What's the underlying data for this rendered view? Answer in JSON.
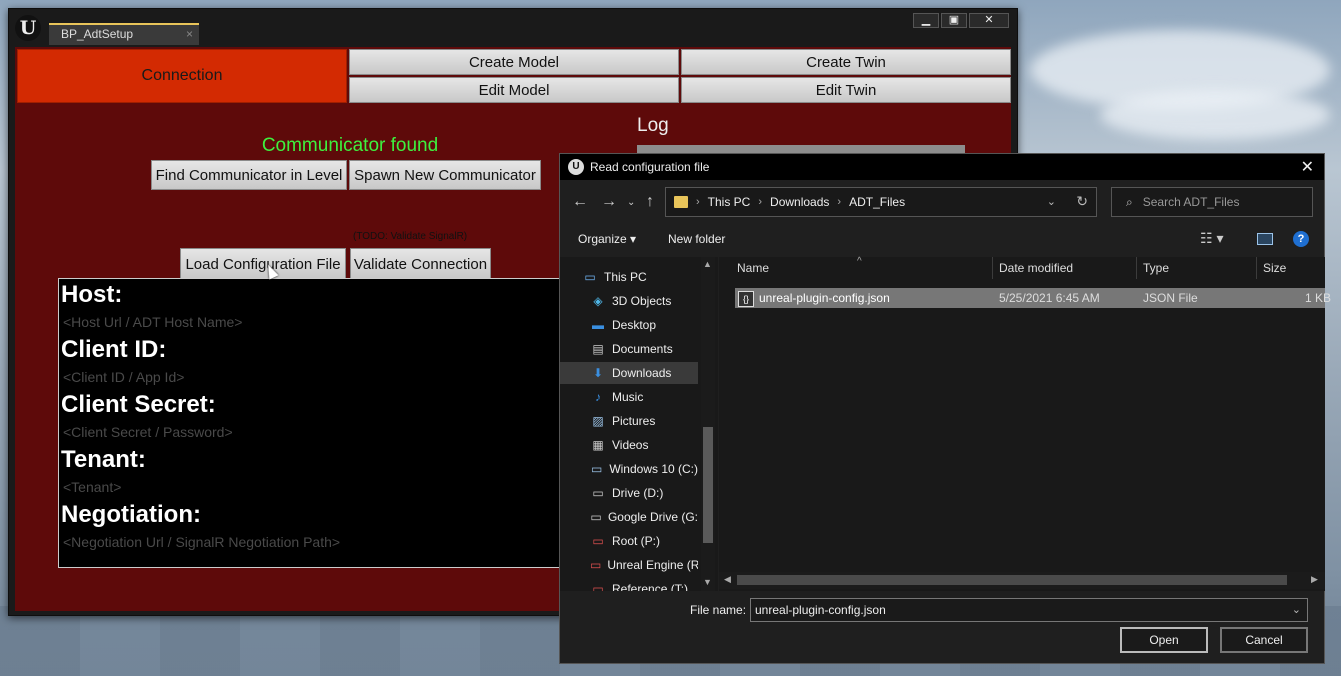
{
  "ue": {
    "logo": "U",
    "tab_title": "BP_AdtSetup",
    "tab_close": "×",
    "ctrl_min": "▁",
    "ctrl_max": "▣",
    "ctrl_close": "✕"
  },
  "nav_buttons": {
    "connection": "Connection",
    "create_model": "Create Model",
    "create_twin": "Create Twin",
    "edit_model": "Edit Model",
    "edit_twin": "Edit Twin"
  },
  "log_label": "Log",
  "status": {
    "communicator": "Communicator found",
    "status_color": "#3ef03e"
  },
  "actions": {
    "find": "Find Communicator in Level",
    "spawn": "Spawn New Communicator",
    "todo": "(TODO: Validate SignalR)",
    "load": "Load Configuration File",
    "validate": "Validate Connection"
  },
  "form": [
    {
      "label": "Host:",
      "hint": "<Host Url / ADT Host Name>"
    },
    {
      "label": "Client ID:",
      "hint": "<Client ID / App Id>"
    },
    {
      "label": "Client Secret:",
      "hint": "<Client Secret / Password>"
    },
    {
      "label": "Tenant:",
      "hint": "<Tenant>"
    },
    {
      "label": "Negotiation:",
      "hint": "<Negotiation Url / SignalR Negotiation Path>"
    }
  ],
  "dialog": {
    "title": "Read configuration file",
    "breadcrumb": [
      "This PC",
      "Downloads",
      "ADT_Files"
    ],
    "search_placeholder": "Search ADT_Files",
    "organize": "Organize ▾",
    "new_folder": "New folder",
    "nav_items": [
      {
        "label": "This PC",
        "icon": "🖥"
      },
      {
        "label": "3D Objects",
        "icon": "◈"
      },
      {
        "label": "Desktop",
        "icon": "▬"
      },
      {
        "label": "Documents",
        "icon": "▤"
      },
      {
        "label": "Downloads",
        "icon": "⬇"
      },
      {
        "label": "Music",
        "icon": "♪"
      },
      {
        "label": "Pictures",
        "icon": "▨"
      },
      {
        "label": "Videos",
        "icon": "▦"
      },
      {
        "label": "Windows 10 (C:)",
        "icon": "▭"
      },
      {
        "label": "Drive (D:)",
        "icon": "▭"
      },
      {
        "label": "Google Drive (G:",
        "icon": "▭"
      },
      {
        "label": "Root (P:)",
        "icon": "▭"
      },
      {
        "label": "Unreal Engine (R",
        "icon": "▭"
      },
      {
        "label": "Reference (T:)",
        "icon": "▭"
      }
    ],
    "columns": [
      "Name",
      "Date modified",
      "Type",
      "Size"
    ],
    "file": {
      "name": "unreal-plugin-config.json",
      "date": "5/25/2021 6:45 AM",
      "type": "JSON File",
      "size": "1 KB"
    },
    "file_name_label": "File name:",
    "file_name_value": "unreal-plugin-config.json",
    "open": "Open",
    "cancel": "Cancel"
  }
}
